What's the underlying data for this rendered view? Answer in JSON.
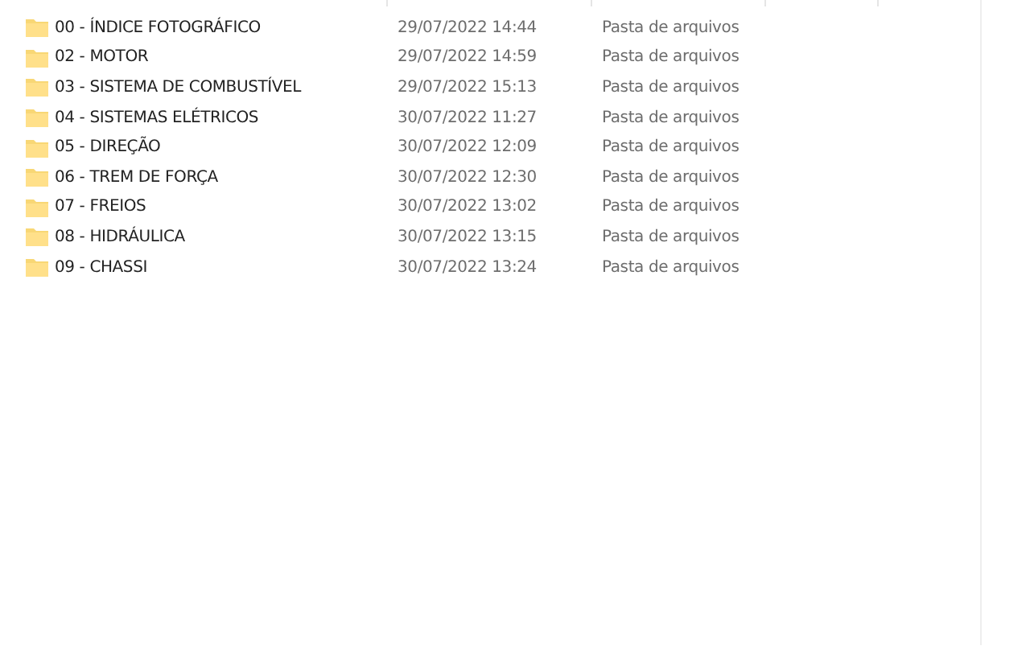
{
  "files": [
    {
      "name": "00 - ÍNDICE FOTOGRÁFICO",
      "modified": "29/07/2022 14:44",
      "type": "Pasta de arquivos"
    },
    {
      "name": "02 - MOTOR",
      "modified": "29/07/2022 14:59",
      "type": "Pasta de arquivos"
    },
    {
      "name": "03 - SISTEMA DE COMBUSTÍVEL",
      "modified": "29/07/2022 15:13",
      "type": "Pasta de arquivos"
    },
    {
      "name": "04 - SISTEMAS ELÉTRICOS",
      "modified": "30/07/2022 11:27",
      "type": "Pasta de arquivos"
    },
    {
      "name": "05 - DIREÇÃO",
      "modified": "30/07/2022 12:09",
      "type": "Pasta de arquivos"
    },
    {
      "name": "06 - TREM DE FORÇA",
      "modified": "30/07/2022 12:30",
      "type": "Pasta de arquivos"
    },
    {
      "name": "07 - FREIOS",
      "modified": "30/07/2022 13:02",
      "type": "Pasta de arquivos"
    },
    {
      "name": "08 - HIDRÁULICA",
      "modified": "30/07/2022 13:15",
      "type": "Pasta de arquivos"
    },
    {
      "name": "09 - CHASSI",
      "modified": "30/07/2022 13:24",
      "type": "Pasta de arquivos"
    }
  ]
}
